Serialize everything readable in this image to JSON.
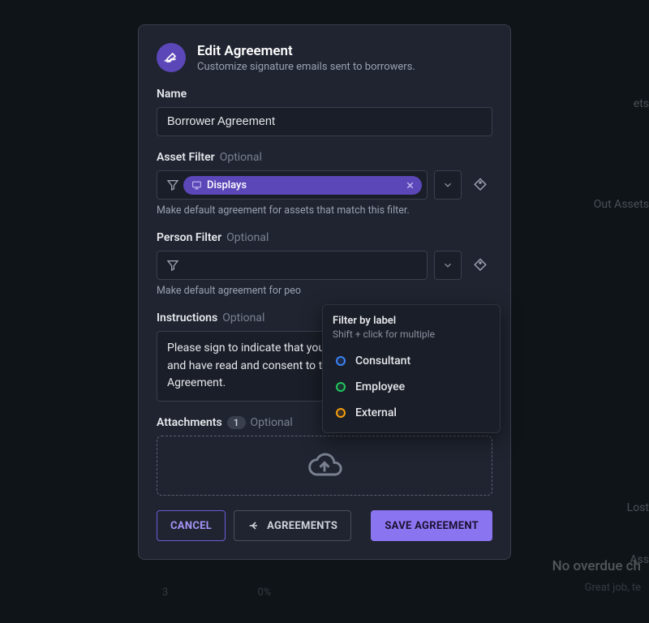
{
  "background": {
    "rightItems": [
      "ets",
      "Out Assets",
      "Lost",
      "Ass"
    ],
    "stats": [
      "3",
      "0%"
    ],
    "overdueTitle": "No overdue ch",
    "overdueSub": "Great job, te"
  },
  "modal": {
    "title": "Edit Agreement",
    "subtitle": "Customize signature emails sent to borrowers.",
    "name": {
      "label": "Name",
      "value": "Borrower Agreement"
    },
    "assetFilter": {
      "label": "Asset Filter",
      "optional": "Optional",
      "chip": "Displays",
      "hint": "Make default agreement for assets that match this filter."
    },
    "personFilter": {
      "label": "Person Filter",
      "optional": "Optional",
      "hint": "Make default agreement for peo"
    },
    "instructions": {
      "label": "Instructions",
      "optional": "Optional",
      "value": "Please sign to indicate that you have received the items below and have read and consent to the attached Borrower Agreement."
    },
    "attachments": {
      "label": "Attachments",
      "count": "1",
      "optional": "Optional"
    },
    "buttons": {
      "cancel": "CANCEL",
      "agreements": "AGREEMENTS",
      "save": "SAVE AGREEMENT"
    }
  },
  "popover": {
    "title": "Filter by label",
    "hint": "Shift + click for multiple",
    "labels": [
      {
        "name": "Consultant",
        "color": "blue"
      },
      {
        "name": "Employee",
        "color": "green"
      },
      {
        "name": "External",
        "color": "orange"
      }
    ]
  }
}
